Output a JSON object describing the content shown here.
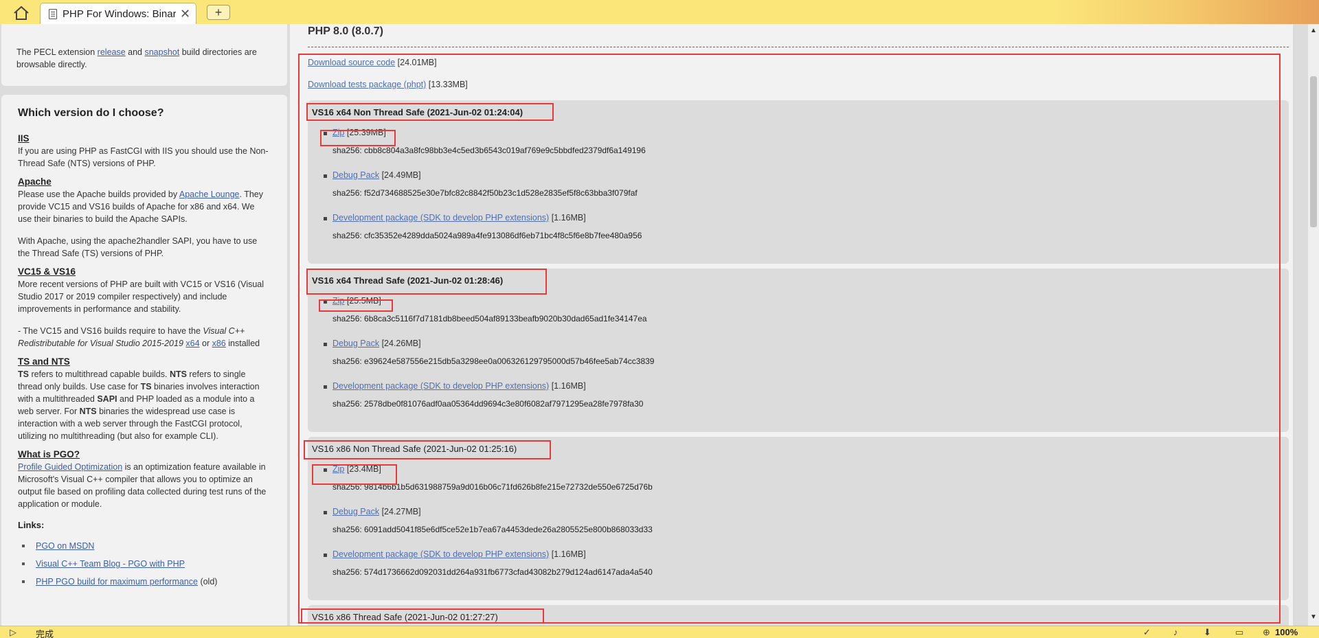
{
  "browser": {
    "tab_title": "PHP For Windows: Binaries and sources Releases",
    "tab_close": "✕",
    "new_tab": "+",
    "status_text": "完成",
    "zoom": "100%"
  },
  "sidebar": {
    "pecl": {
      "text_before": "The PECL extension ",
      "link_release": "release",
      "text_and": " and ",
      "link_snapshot": "snapshot",
      "text_after": " build directories are browsable directly."
    },
    "choose": {
      "title": "Which version do I choose?",
      "iis_heading": "IIS",
      "iis_text": "If you are using PHP as FastCGI with IIS you should use the Non-Thread Safe (NTS) versions of PHP.",
      "apache_heading": "Apache",
      "apache_text_before": "Please use the Apache builds provided by ",
      "apache_link": "Apache Lounge",
      "apache_text_after": ". They provide VC15 and VS16 builds of Apache for x86 and x64. We use their binaries to build the Apache SAPIs.",
      "apache_text2": "With Apache, using the apache2handler SAPI, you have to use the Thread Safe (TS) versions of PHP.",
      "vc_heading": "VC15 & VS16",
      "vc_text": "More recent versions of PHP are built with VC15 or VS16 (Visual Studio 2017 or 2019 compiler respectively) and include improvements in performance and stability.",
      "vc_text2_before": "- The VC15 and VS16 builds require to have the ",
      "vc_text2_em": "Visual C++ Redistributable for Visual Studio 2015-2019",
      "vc_link_x64": "x64",
      "vc_text2_or": " or ",
      "vc_link_x86": "x86",
      "vc_text2_after": " installed",
      "ts_heading": "TS and NTS",
      "ts_b1": "TS",
      "ts_t1": " refers to multithread capable builds. ",
      "ts_b2": "NTS",
      "ts_t2": " refers to single thread only builds. Use case for ",
      "ts_b3": "TS",
      "ts_t3": " binaries involves interaction with a multithreaded ",
      "ts_b4": "SAPI",
      "ts_t4": " and PHP loaded as a module into a web server. For ",
      "ts_b5": "NTS",
      "ts_t5": " binaries the widespread use case is interaction with a web server through the FastCGI protocol, utilizing no multithreading (but also for example CLI).",
      "pgo_heading": "What is PGO?",
      "pgo_link": "Profile Guided Optimization",
      "pgo_text": " is an optimization feature available in Microsoft's Visual C++ compiler that allows you to optimize an output file based on profiling data collected during test runs of the application or module.",
      "links_title": "Links:",
      "links": [
        {
          "label": "PGO on MSDN",
          "suffix": ""
        },
        {
          "label": "Visual C++ Team Blog - PGO with PHP",
          "suffix": ""
        },
        {
          "label": "PHP PGO build for maximum performance",
          "suffix": " (old)"
        }
      ]
    }
  },
  "main": {
    "version_heading": "PHP 8.0 (8.0.7)",
    "source_link": "Download source code",
    "source_size": " [24.01MB]",
    "tests_link": "Download tests package (phpt)",
    "tests_size": " [13.33MB]",
    "builds": [
      {
        "title": "VS16 x64 Non Thread Safe (2021-Jun-02 01:24:04)",
        "zip_label": "Zip",
        "zip_size": " [25.39MB]",
        "zip_sha": "sha256: cbb8c804a3a8fc98bb3e4c5ed3b6543c019af769e9c5bbdfed2379df6a149196",
        "debug_label": "Debug Pack",
        "debug_size": " [24.49MB]",
        "debug_sha": "sha256: f52d734688525e30e7bfc82c8842f50b23c1d528e2835ef5f8c63bba3f079faf",
        "dev_label": "Development package (SDK to develop PHP extensions)",
        "dev_size": " [1.16MB]",
        "dev_sha": "sha256: cfc35352e4289dda5024a989a4fe913086df6eb71bc4f8c5f6e8b7fee480a956"
      },
      {
        "title": "VS16 x64 Thread Safe (2021-Jun-02 01:28:46)",
        "zip_label": "Zip",
        "zip_size": " [25.5MB]",
        "zip_sha": "sha256: 6b8ca3c5116f7d7181db8beed504af89133beafb9020b30dad65ad1fe34147ea",
        "debug_label": "Debug Pack",
        "debug_size": " [24.26MB]",
        "debug_sha": "sha256: e39624e587556e215db5a3298ee0a006326129795000d57b46fee5ab74cc3839",
        "dev_label": "Development package (SDK to develop PHP extensions)",
        "dev_size": " [1.16MB]",
        "dev_sha": "sha256: 2578dbe0f81076adf0aa05364dd9694c3e80f6082af7971295ea28fe7978fa30"
      },
      {
        "title": "VS16 x86 Non Thread Safe (2021-Jun-02 01:25:16)",
        "zip_label": "Zip",
        "zip_size": " [23.4MB]",
        "zip_sha": "sha256: 9814b6b1b5d631988759a9d016b06c71fd626b8fe215e72732de550e6725d76b",
        "debug_label": "Debug Pack",
        "debug_size": " [24.27MB]",
        "debug_sha": "sha256: 6091add5041f85e6df5ce52e1b7ea67a4453dede26a2805525e800b868033d33",
        "dev_label": "Development package (SDK to develop PHP extensions)",
        "dev_size": " [1.16MB]",
        "dev_sha": "sha256: 574d1736662d092031dd264a931fb6773cfad43082b279d124ad6147ada4a540"
      },
      {
        "title": "VS16 x86 Thread Safe (2021-Jun-02 01:27:27)"
      }
    ]
  }
}
